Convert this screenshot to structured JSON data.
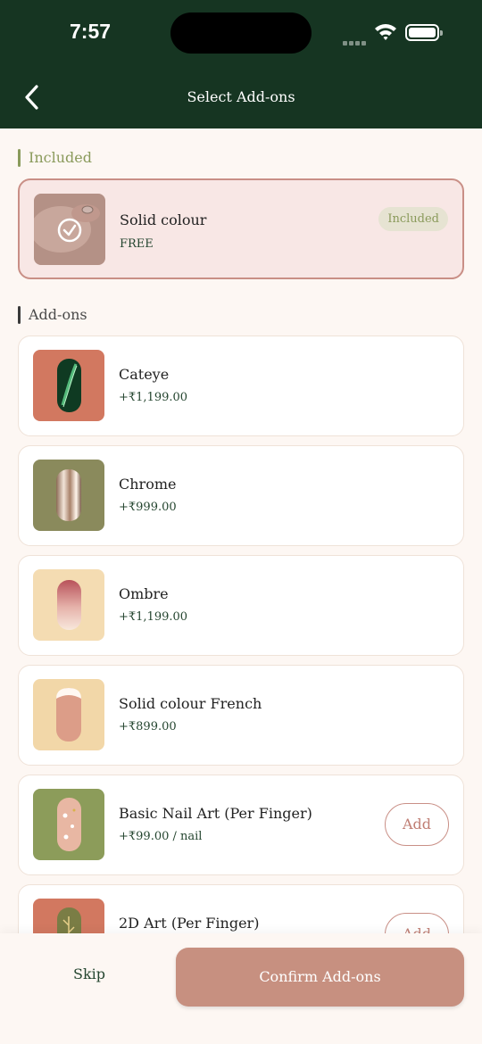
{
  "status_bar": {
    "time": "7:57"
  },
  "header": {
    "title": "Select Add-ons"
  },
  "sections": {
    "included_title": "Included",
    "addons_title": "Add-ons"
  },
  "included_item": {
    "name": "Solid colour",
    "price": "FREE",
    "badge": "Included"
  },
  "addons": [
    {
      "name": "Cateye",
      "price": "+₹1,199.00"
    },
    {
      "name": "Chrome",
      "price": "+₹999.00"
    },
    {
      "name": "Ombre",
      "price": "+₹1,199.00"
    },
    {
      "name": "Solid colour French",
      "price": "+₹899.00"
    },
    {
      "name": "Basic Nail Art (Per Finger)",
      "price": "+₹99.00 / nail",
      "button": "Add"
    },
    {
      "name": "2D Art (Per Finger)",
      "price": "",
      "button": "Add"
    }
  ],
  "footer": {
    "skip_label": "Skip",
    "confirm_label": "Confirm Add-ons"
  },
  "colors": {
    "header_bg": "#163522",
    "accent": "#c79080",
    "included_green": "#8a9a5b",
    "price_green": "#24452f"
  },
  "icons": [
    "back-arrow-icon",
    "wifi-icon",
    "battery-icon",
    "check-circle-icon"
  ]
}
